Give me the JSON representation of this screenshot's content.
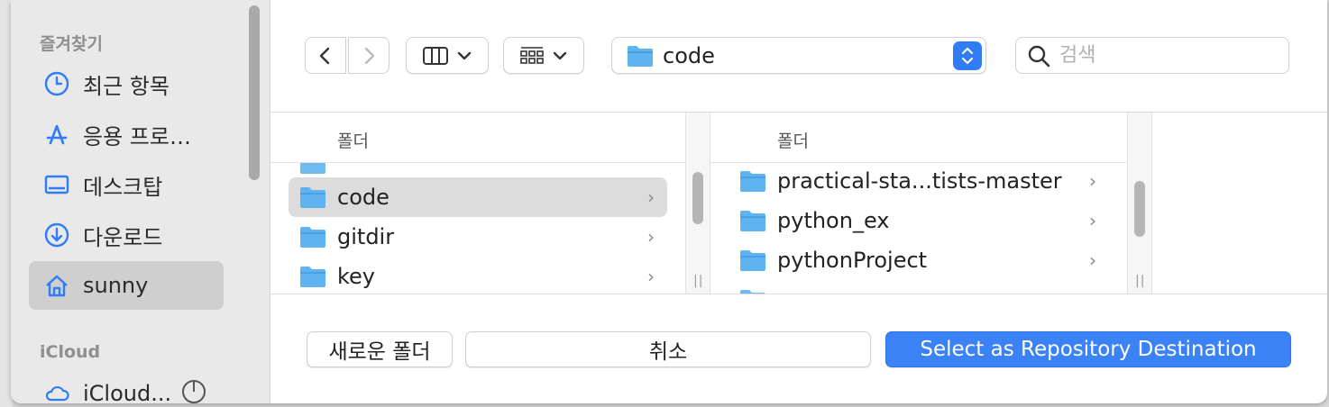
{
  "sidebar": {
    "favorites_heading": "즐겨찾기",
    "items": [
      {
        "label": "최근 항목",
        "icon": "clock-icon"
      },
      {
        "label": "응용 프로…",
        "icon": "applications-icon"
      },
      {
        "label": "데스크탑",
        "icon": "desktop-icon"
      },
      {
        "label": "다운로드",
        "icon": "download-icon"
      },
      {
        "label": "sunny",
        "icon": "home-icon",
        "selected": true
      }
    ],
    "icloud_heading": "iCloud",
    "icloud_item": {
      "label": "iCloud...",
      "icon": "cloud-icon"
    }
  },
  "toolbar": {
    "path_label": "code",
    "search_placeholder": "검색"
  },
  "columns": [
    {
      "header": "폴더",
      "rows": [
        {
          "label": "code",
          "selected": true
        },
        {
          "label": "gitdir"
        },
        {
          "label": "key"
        }
      ]
    },
    {
      "header": "폴더",
      "rows": [
        {
          "label": "practical-sta...tists-master"
        },
        {
          "label": "python_ex"
        },
        {
          "label": "pythonProject"
        }
      ]
    }
  ],
  "buttons": {
    "new_folder": "새로운 폴더",
    "cancel": "취소",
    "confirm": "Select as Repository Destination"
  },
  "colors": {
    "accent": "#3b82f6",
    "folder": "#5fb3f0",
    "sidebar_bg": "#e9e9e9",
    "icon_blue": "#2f7cf6"
  }
}
